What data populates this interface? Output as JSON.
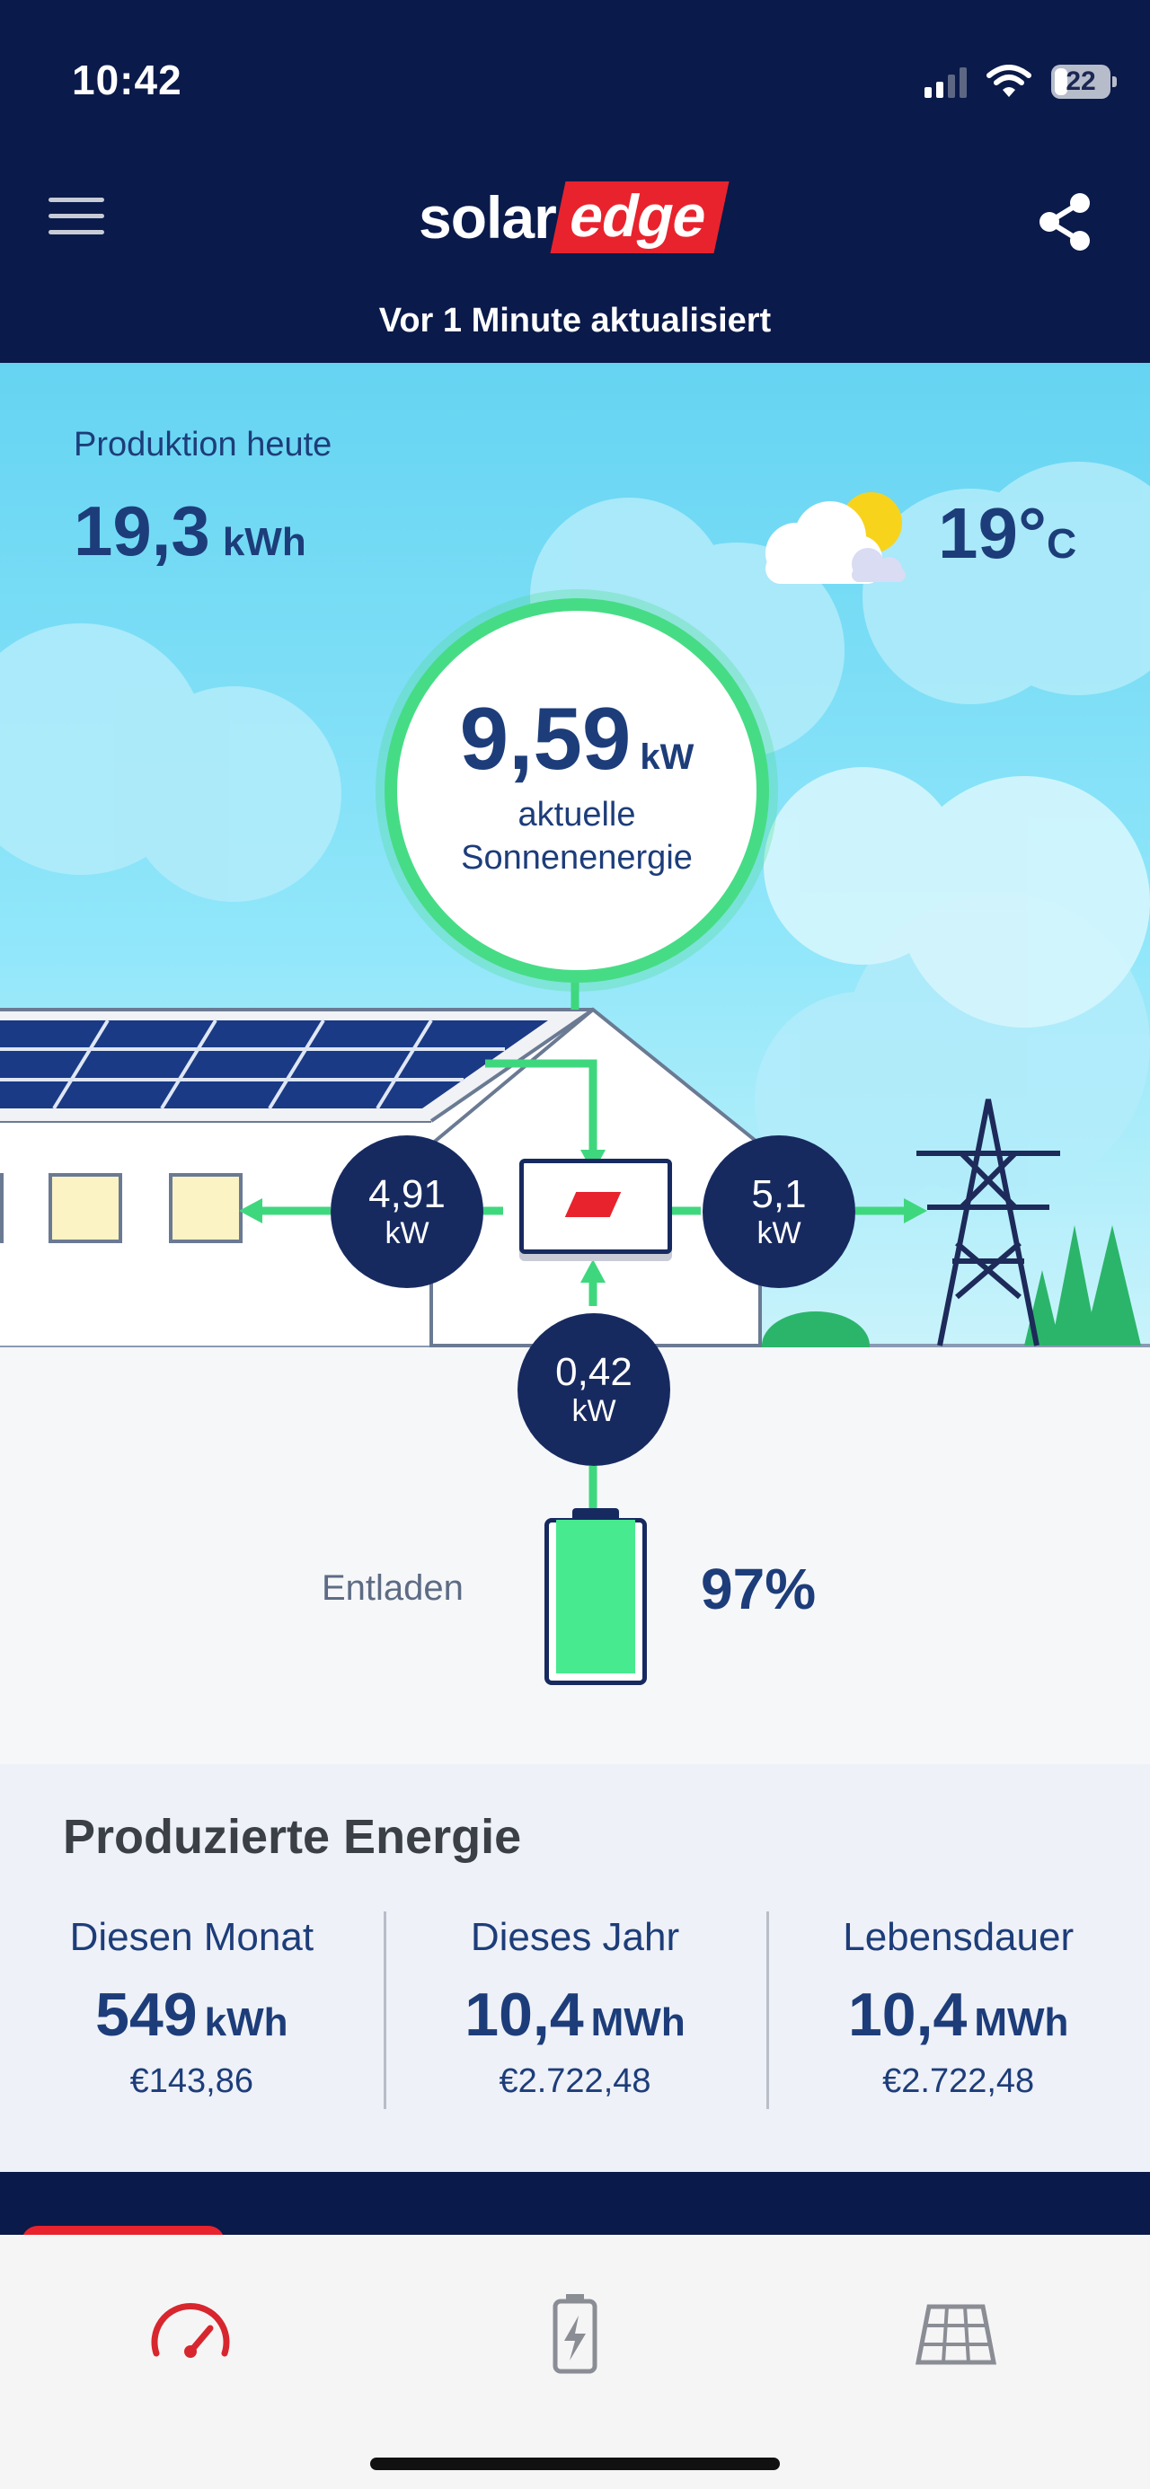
{
  "status_bar": {
    "time": "10:42",
    "battery_level": "22"
  },
  "header": {
    "logo_part1": "solar",
    "logo_part2": "edge",
    "updated": "Vor 1 Minute aktualisiert"
  },
  "production_today": {
    "label": "Produktion heute",
    "value": "19,3",
    "unit": "kWh"
  },
  "weather": {
    "icon": "partly-cloudy-icon",
    "temperature": "19°",
    "unit": "C"
  },
  "solar_power": {
    "value": "9,59",
    "unit": "kW",
    "label_line1": "aktuelle",
    "label_line2": "Sonnenenergie"
  },
  "flows": {
    "home": {
      "value": "4,91",
      "unit": "kW"
    },
    "grid": {
      "value": "5,1",
      "unit": "kW"
    },
    "battery": {
      "value": "0,42",
      "unit": "kW"
    }
  },
  "battery": {
    "status": "Entladen",
    "percent": "97%",
    "fill_fraction": 0.97
  },
  "produced_energy": {
    "title": "Produzierte Energie",
    "columns": [
      {
        "label": "Diesen Monat",
        "value": "549",
        "unit": "kWh",
        "money": "€143,86"
      },
      {
        "label": "Dieses Jahr",
        "value": "10,4",
        "unit": "MWh",
        "money": "€2.722,48"
      },
      {
        "label": "Lebensdauer",
        "value": "10,4",
        "unit": "MWh",
        "money": "€2.722,48"
      }
    ]
  },
  "colors": {
    "navy": "#0a1a4a",
    "node": "#172a60",
    "accent_green": "#46dc85",
    "brand_red": "#e8232d",
    "text_blue": "#1d3d7a"
  },
  "tabs": [
    {
      "icon": "speedometer-icon",
      "active": true
    },
    {
      "icon": "battery-charging-icon",
      "active": false
    },
    {
      "icon": "solar-panel-grid-icon",
      "active": false
    }
  ]
}
